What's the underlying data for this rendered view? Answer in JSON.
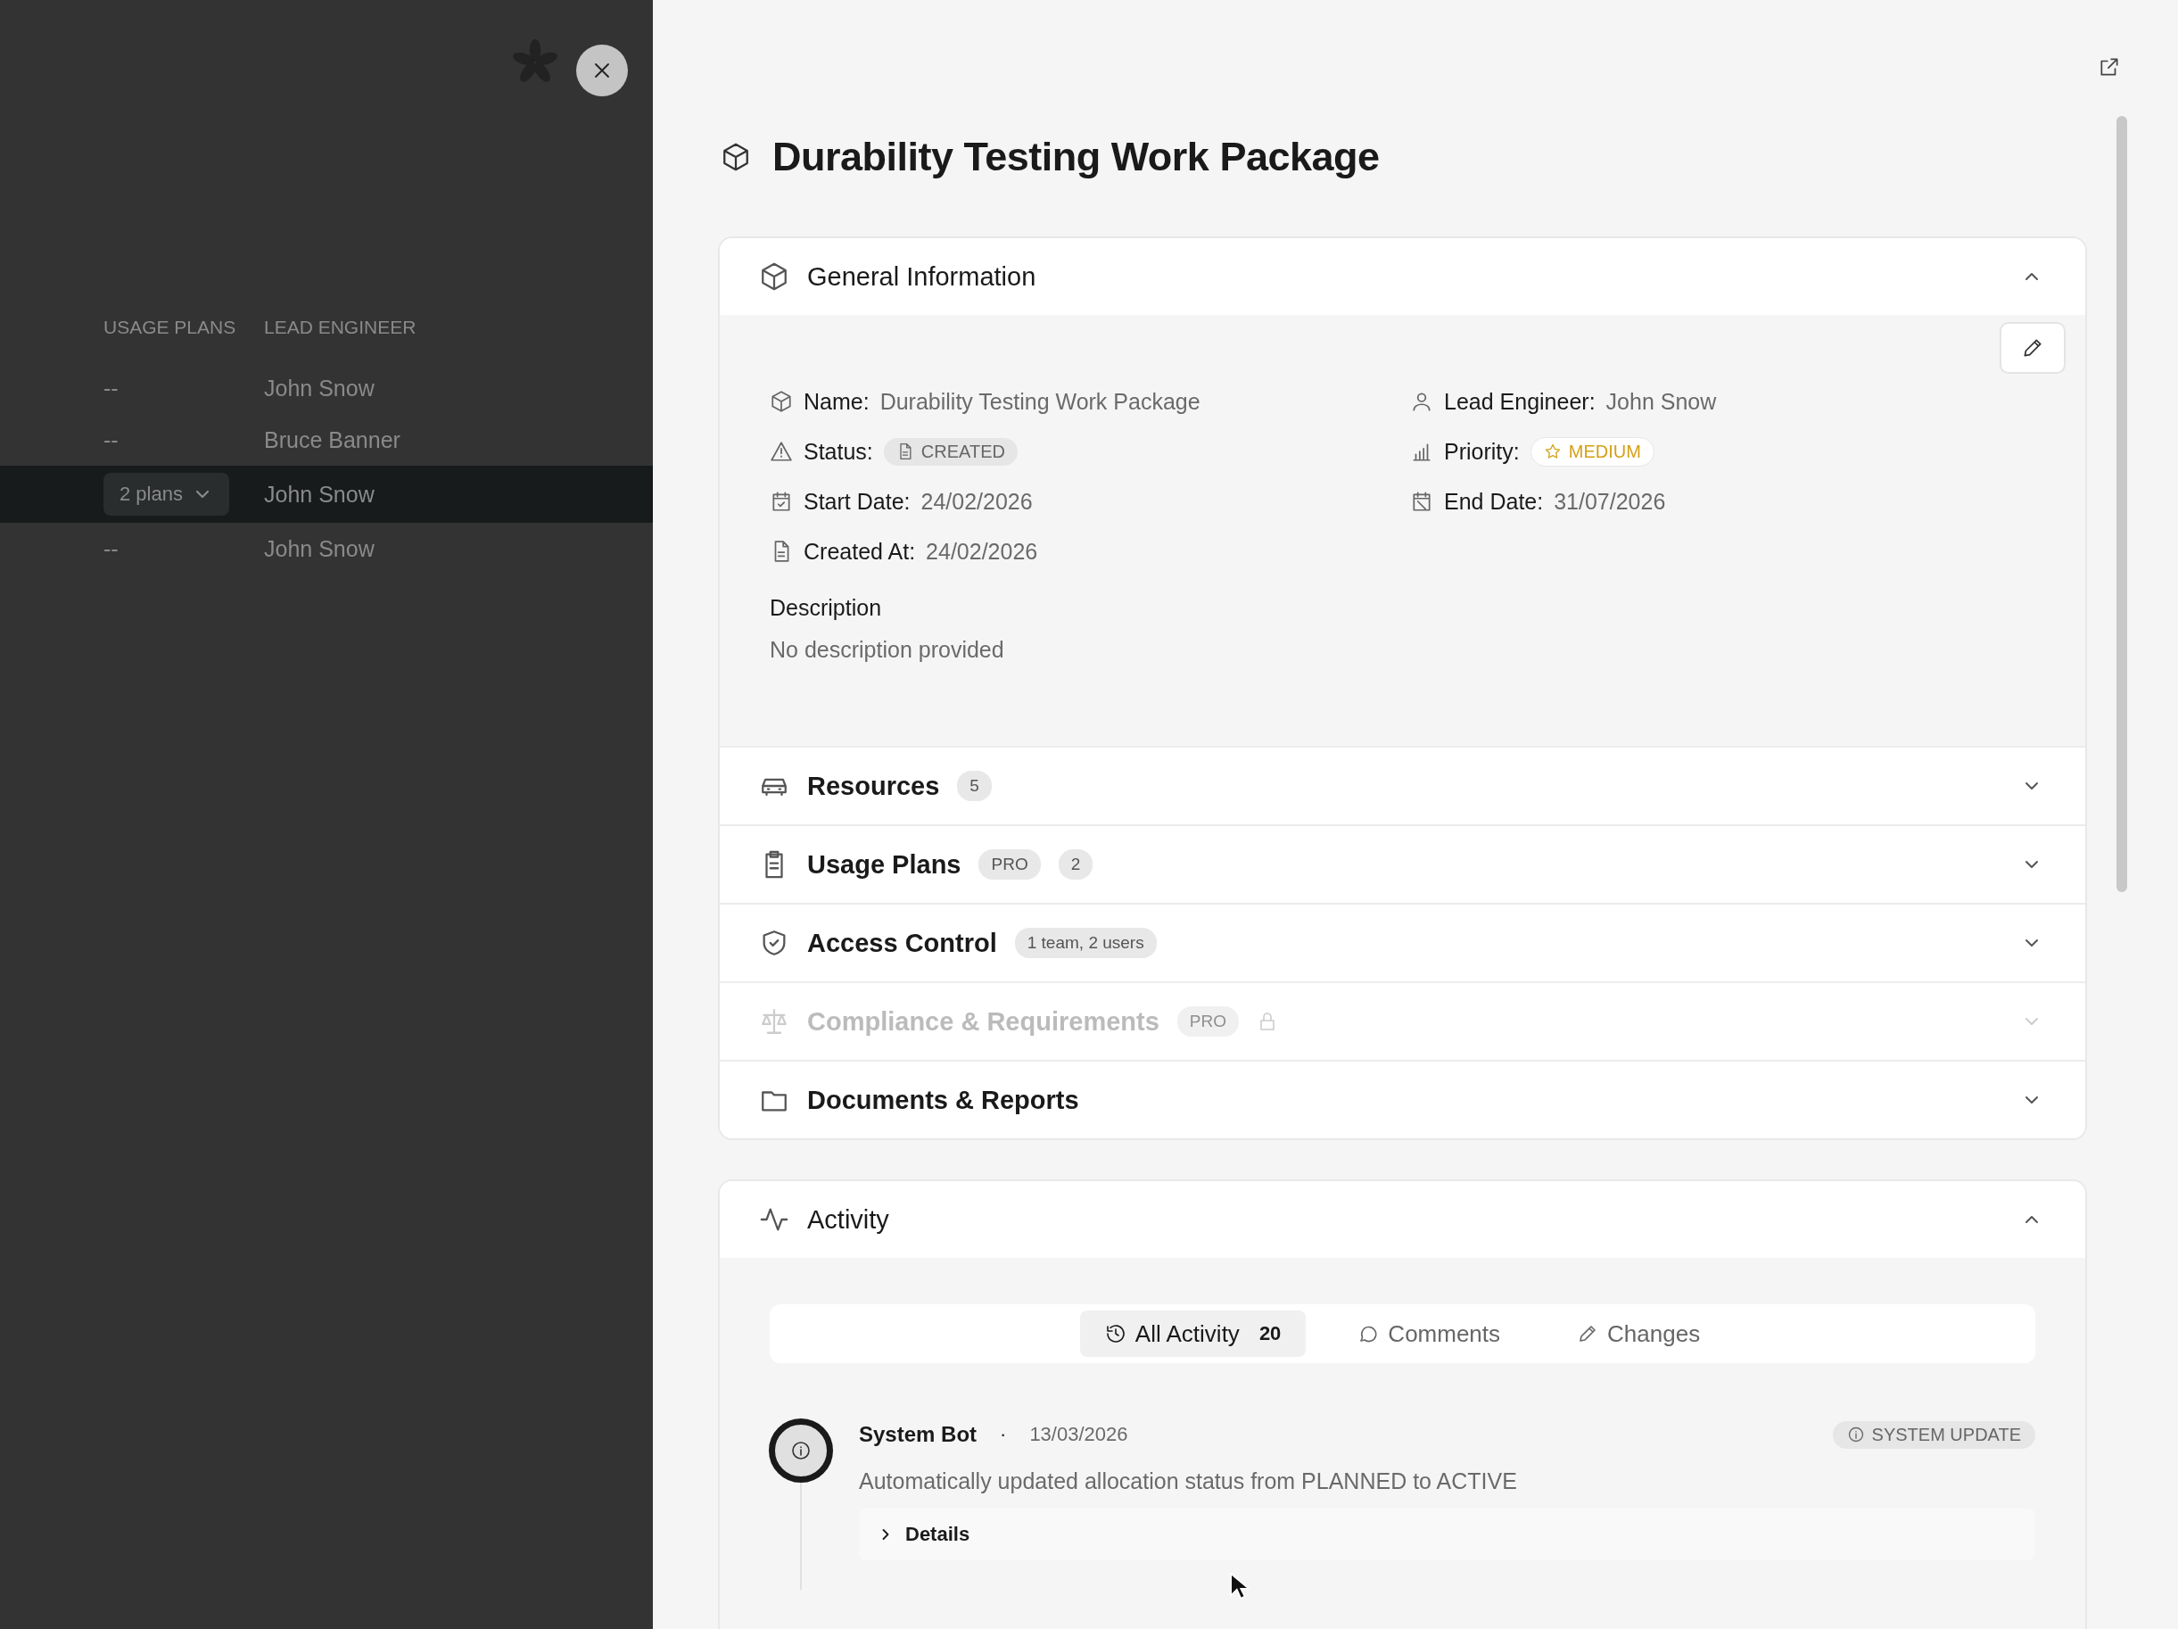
{
  "backdrop": {
    "table": {
      "columns": [
        "USAGE PLANS",
        "LEAD ENGINEER"
      ],
      "rows": [
        {
          "usage_plans": "--",
          "kind": "text",
          "lead_engineer": "John Snow",
          "selected": false
        },
        {
          "usage_plans": "--",
          "kind": "text",
          "lead_engineer": "Bruce Banner",
          "selected": false
        },
        {
          "usage_plans": "2 plans",
          "kind": "dropdown",
          "lead_engineer": "John Snow",
          "selected": true
        },
        {
          "usage_plans": "--",
          "kind": "text",
          "lead_engineer": "John Snow",
          "selected": false
        }
      ]
    }
  },
  "drawer": {
    "title": "Durability Testing Work Package",
    "general_information": {
      "title": "General Information",
      "expanded": true,
      "fields": [
        {
          "label": "Name:",
          "value": "Durability Testing Work Package",
          "kind": "text"
        },
        {
          "label": "Lead Engineer:",
          "value": "John Snow",
          "kind": "text"
        },
        {
          "label": "Status:",
          "value": "CREATED",
          "kind": "status"
        },
        {
          "label": "Priority:",
          "value": "MEDIUM",
          "kind": "priority"
        },
        {
          "label": "Start Date:",
          "value": "24/02/2026",
          "kind": "text"
        },
        {
          "label": "End Date:",
          "value": "31/07/2026",
          "kind": "text"
        },
        {
          "label": "Created At:",
          "value": "24/02/2026",
          "kind": "text"
        }
      ],
      "description": {
        "label": "Description",
        "value": "No description provided"
      }
    },
    "sections": [
      {
        "title": "Resources",
        "badges": [
          "5"
        ],
        "expanded": false,
        "disabled": false,
        "locked": false
      },
      {
        "title": "Usage Plans",
        "badges": [
          "PRO",
          "2"
        ],
        "expanded": false,
        "disabled": false,
        "locked": false
      },
      {
        "title": "Access Control",
        "badges": [
          "1 team, 2 users"
        ],
        "expanded": false,
        "disabled": false,
        "locked": false
      },
      {
        "title": "Compliance & Requirements",
        "badges": [
          "PRO"
        ],
        "expanded": false,
        "disabled": true,
        "locked": true
      },
      {
        "title": "Documents & Reports",
        "expanded": false,
        "disabled": false,
        "locked": false
      }
    ],
    "activity": {
      "title": "Activity",
      "expanded": true,
      "tabs": [
        {
          "label": "All Activity",
          "count": "20",
          "selected": true
        },
        {
          "label": "Comments",
          "selected": false
        },
        {
          "label": "Changes",
          "selected": false
        }
      ],
      "entries": [
        {
          "author": "System Bot",
          "separator": "·",
          "date": "13/03/2026",
          "tag": "SYSTEM UPDATE",
          "message": "Automatically updated allocation status from PLANNED to ACTIVE",
          "details": {
            "label": "Details",
            "expanded": false
          }
        }
      ]
    }
  }
}
